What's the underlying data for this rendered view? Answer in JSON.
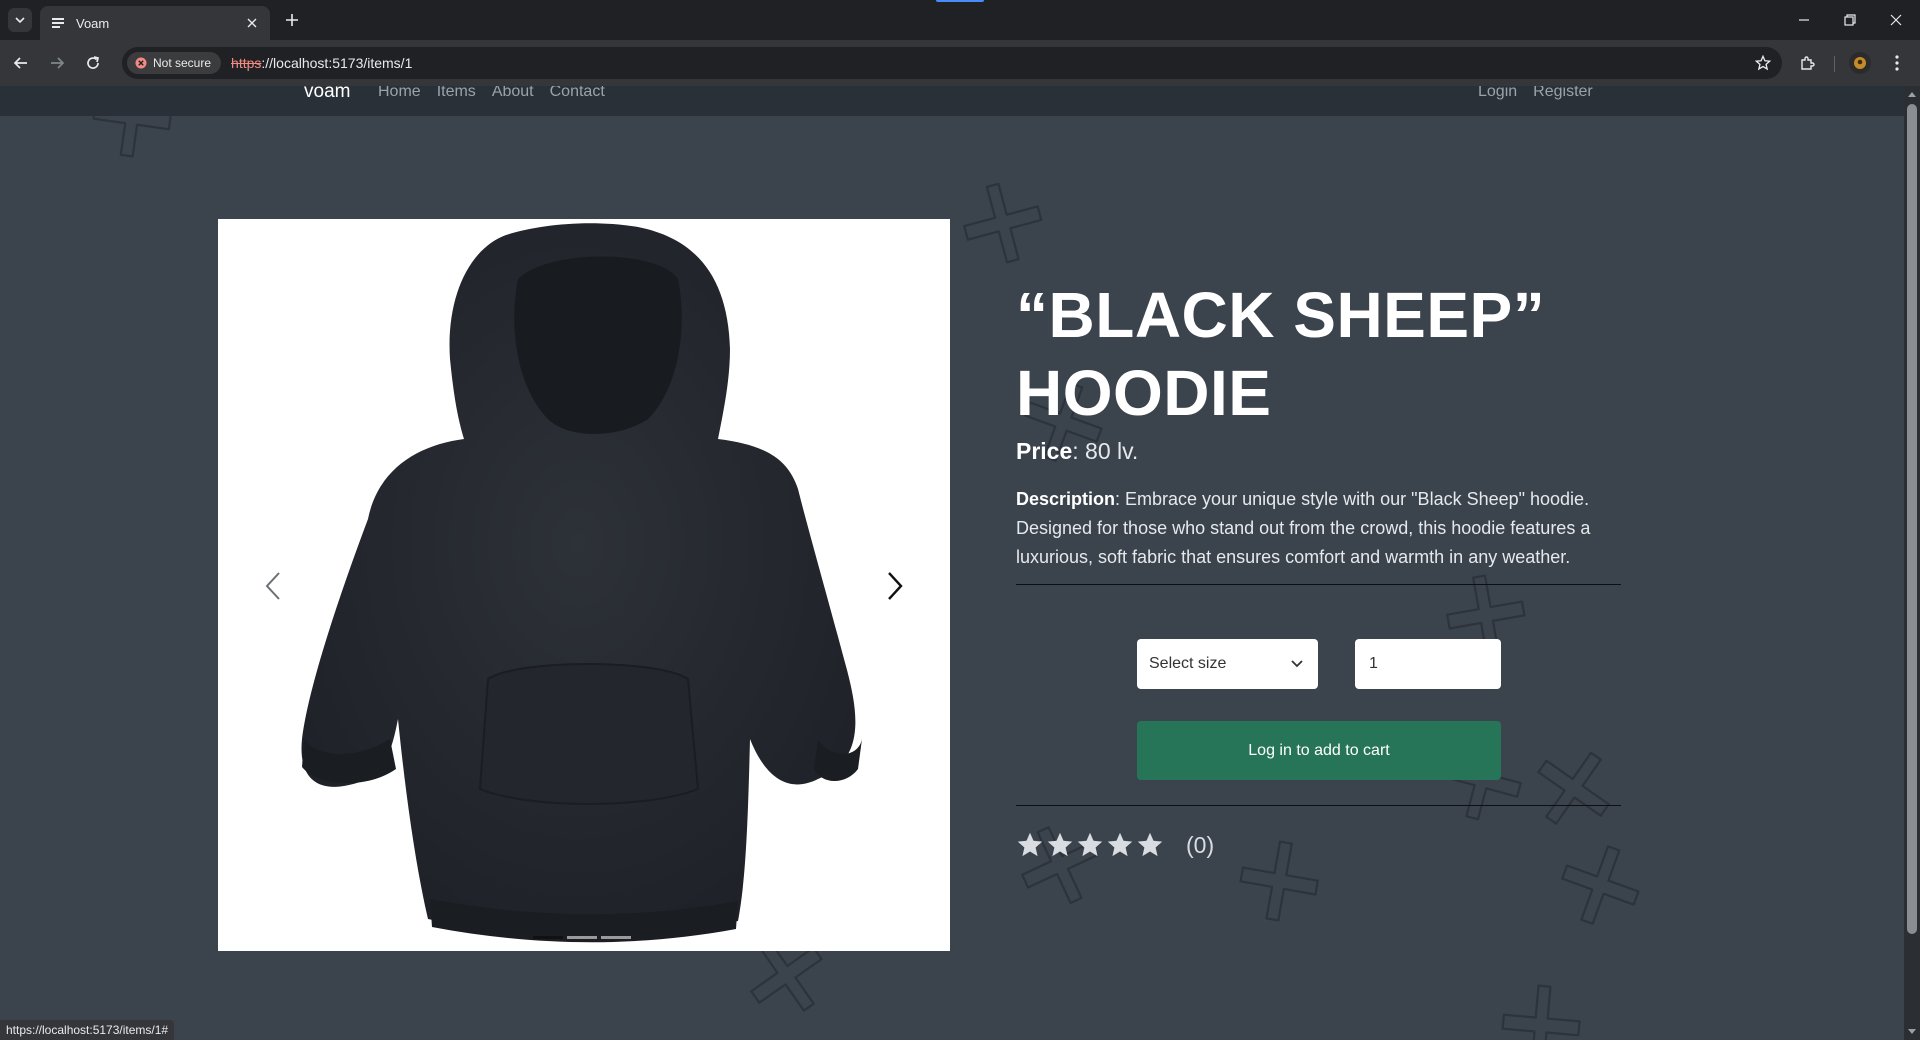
{
  "browser": {
    "tab_title": "Voam",
    "security_label": "Not secure",
    "url_scheme": "https",
    "url_rest": "://localhost:5173/items/1",
    "status_url": "https://localhost:5173/items/1#"
  },
  "navbar": {
    "brand": "voam",
    "links": [
      "Home",
      "Items",
      "About",
      "Contact"
    ],
    "auth": [
      "Login",
      "Register"
    ]
  },
  "product": {
    "title_line1": "“BLACK SHEEP”",
    "title_line2": "HOODIE",
    "price_label": "Price",
    "price_value": ": 80 lv.",
    "description_label": "Description",
    "description_text": ": Embrace your unique style with our \"Black Sheep\" hoodie. Designed for those who stand out from the crowd, this hoodie features a luxurious, soft fabric that ensures comfort and warmth in any weather.",
    "size_select": "Select size",
    "quantity": "1",
    "cart_button": "Log in to add to cart",
    "rating_stars": 0,
    "rating_count": "(0)"
  },
  "carousel": {
    "slide_count": 3,
    "active_slide": 1
  }
}
